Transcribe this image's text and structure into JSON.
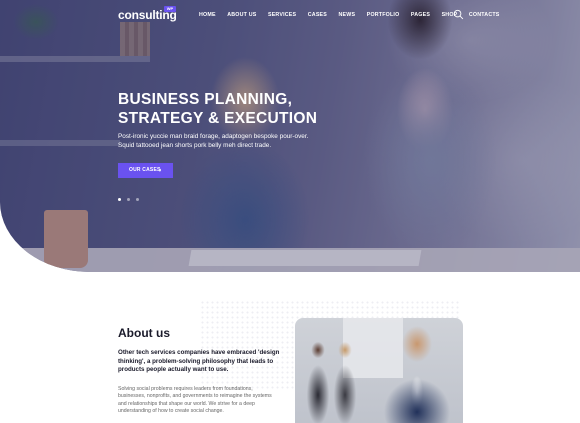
{
  "header": {
    "logo_text": "consulting",
    "logo_badge": "WP",
    "nav": [
      "HOME",
      "ABOUT US",
      "SERVICES",
      "CASES",
      "NEWS",
      "PORTFOLIO",
      "PAGES",
      "SHOP",
      "CONTACTS"
    ],
    "search_icon": "search-icon"
  },
  "hero": {
    "title_line1": "BUSINESS PLANNING,",
    "title_line2": "STRATEGY & EXECUTION",
    "sub_line1": "Post-ironic yuccie man braid forage, adaptogen bespoke pour-over.",
    "sub_line2": "Squid tattooed jean shorts pork belly meh direct trade.",
    "cta_label": "OUR CASES",
    "cta_icon": "chevron-right-icon",
    "slides_total": 3,
    "active_slide": 1,
    "accent": "#6a52f0"
  },
  "about": {
    "title": "About us",
    "lead_line1": "Other tech services companies have embraced 'design",
    "lead_line2": "thinking', a problem-solving philosophy that leads to",
    "lead_line3": "products people actually want to use.",
    "body_line1": "Solving social problems requires leaders from foundations,",
    "body_line2": "businesses, nonprofits, and governments to reimagine the systems",
    "body_line3": "and relationships that shape our world. We strive for a deep",
    "body_line4": "understanding of how to create social change."
  }
}
